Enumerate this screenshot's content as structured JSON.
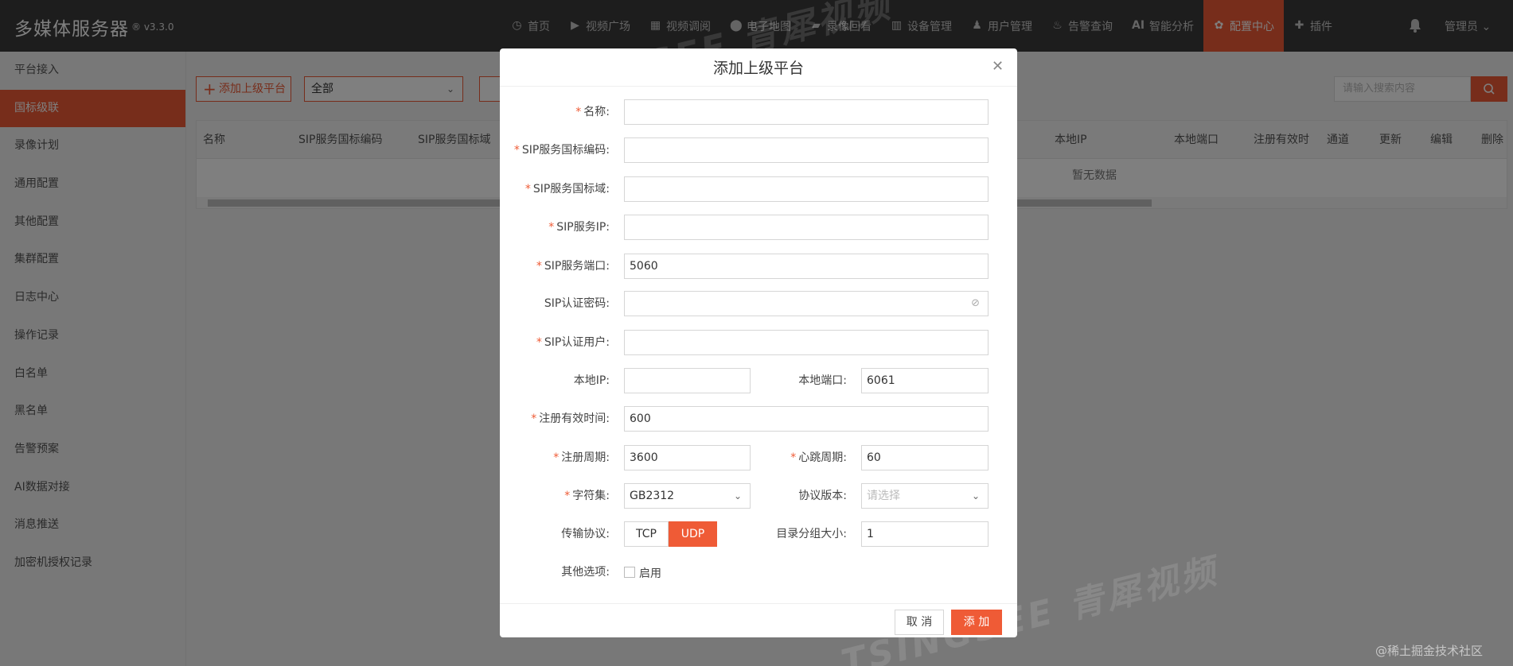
{
  "header": {
    "brand": "多媒体服务器",
    "version": "® v3.3.0",
    "nav": [
      {
        "label": "首页",
        "icon": "dashboard-icon",
        "glyph": "◷"
      },
      {
        "label": "视频广场",
        "icon": "play-circle-icon",
        "glyph": "▶"
      },
      {
        "label": "视频调阅",
        "icon": "video-grid-icon",
        "glyph": "▦"
      },
      {
        "label": "电子地图",
        "icon": "map-pin-icon",
        "glyph": "⬤"
      },
      {
        "label": "录像回看",
        "icon": "video-camera-icon",
        "glyph": "▰"
      },
      {
        "label": "设备管理",
        "icon": "device-icon",
        "glyph": "▥"
      },
      {
        "label": "用户管理",
        "icon": "user-icon",
        "glyph": "♟"
      },
      {
        "label": "告警查询",
        "icon": "alarm-icon",
        "glyph": "♨"
      },
      {
        "label": "智能分析",
        "icon": "ai-icon",
        "glyph": "AI"
      },
      {
        "label": "配置中心",
        "icon": "gear-icon",
        "glyph": "✿"
      },
      {
        "label": "插件",
        "icon": "puzzle-icon",
        "glyph": "✚"
      }
    ],
    "user": "管理员 ⌄",
    "accent": "#ef5b36"
  },
  "sidebar": {
    "items": [
      "平台接入",
      "国标级联",
      "录像计划",
      "通用配置",
      "其他配置",
      "集群配置",
      "日志中心",
      "操作记录",
      "白名单",
      "黑名单",
      "告警预案",
      "AI数据对接",
      "消息推送",
      "加密机授权记录"
    ],
    "active_index": 1
  },
  "toolbar": {
    "add_label": "添加上级平台",
    "filter_value": "全部",
    "search_placeholder": "请输入搜索内容"
  },
  "table": {
    "columns": [
      "名称",
      "SIP服务国标编码",
      "SIP服务国标域",
      "本地IP",
      "本地端口",
      "注册有效时",
      "通道",
      "更新",
      "编辑",
      "删除"
    ],
    "empty_text": "暂无数据"
  },
  "dialog": {
    "title": "添加上级平台",
    "fields": {
      "name": {
        "label": "名称:",
        "value": ""
      },
      "sip_id": {
        "label": "SIP服务国标编码:",
        "value": ""
      },
      "sip_domain": {
        "label": "SIP服务国标域:",
        "value": ""
      },
      "sip_ip": {
        "label": "SIP服务IP:",
        "value": ""
      },
      "sip_port": {
        "label": "SIP服务端口:",
        "value": "5060"
      },
      "sip_password": {
        "label": "SIP认证密码:",
        "value": ""
      },
      "sip_user": {
        "label": "SIP认证用户:",
        "value": ""
      },
      "local_ip": {
        "label": "本地IP:",
        "value": ""
      },
      "local_port": {
        "label": "本地端口:",
        "value": "6061"
      },
      "expires": {
        "label": "注册有效时间:",
        "value": "600"
      },
      "register_cycle": {
        "label": "注册周期:",
        "value": "3600"
      },
      "heartbeat": {
        "label": "心跳周期:",
        "value": "60"
      },
      "charset": {
        "label": "字符集:",
        "value": "GB2312"
      },
      "protocol_version": {
        "label": "协议版本:",
        "placeholder": "请选择"
      },
      "transport": {
        "label": "传输协议:",
        "options": [
          "TCP",
          "UDP"
        ],
        "selected": "UDP"
      },
      "catalog_group": {
        "label": "目录分组大小:",
        "value": "1"
      },
      "other": {
        "label": "其他选项:",
        "checkbox_label": "启用",
        "checked": false
      }
    },
    "required_mark": "*",
    "cancel_label": "取 消",
    "submit_label": "添 加"
  },
  "watermark": "TSINGSEE 青犀视频",
  "credit": "@稀土掘金技术社区"
}
